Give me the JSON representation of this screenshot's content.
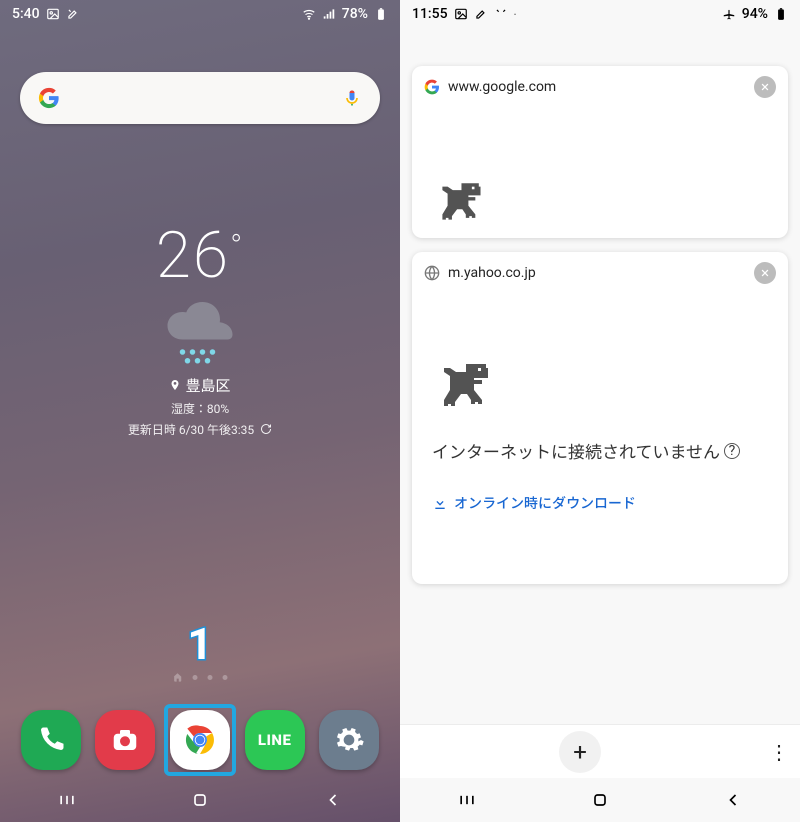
{
  "left": {
    "status": {
      "time": "5:40",
      "battery": "78%",
      "icons": [
        "picture-icon",
        "tools-icon",
        "wifi-icon",
        "signal-icon",
        "battery-icon"
      ]
    },
    "search": {
      "provider": "Google",
      "placeholder": ""
    },
    "weather": {
      "temperature": "26",
      "degree": "°",
      "condition": "rain",
      "location": "豊島区",
      "humidity_label": "湿度：80%",
      "updated_label": "更新日時 6/30 午後3:35"
    },
    "annotation": "1",
    "dock": [
      {
        "name": "phone-app",
        "label": "電話",
        "color": "#1fa954"
      },
      {
        "name": "camera-app",
        "label": "カメラ",
        "color": "#e23b4a"
      },
      {
        "name": "chrome-app",
        "label": "Chrome",
        "highlighted": true
      },
      {
        "name": "line-app",
        "label": "LINE",
        "color": "#2cc755"
      },
      {
        "name": "settings-app",
        "label": "設定",
        "color": "#6c7d8e"
      }
    ]
  },
  "right": {
    "status": {
      "time": "11:55",
      "battery": "94%",
      "icons": [
        "picture-icon",
        "wrench-icon",
        "tools-icon",
        "airplane-icon",
        "battery-icon"
      ]
    },
    "tabs": [
      {
        "favicon": "google",
        "title": "www.google.com"
      },
      {
        "favicon": "globe",
        "title": "m.yahoo.co.jp",
        "offline_message": "インターネットに接続されていません",
        "download_link": "オンライン時にダウンロード"
      }
    ],
    "bottom": {
      "new_tab": "+",
      "more": "⋮"
    }
  },
  "nav": [
    "recent",
    "home",
    "back"
  ]
}
